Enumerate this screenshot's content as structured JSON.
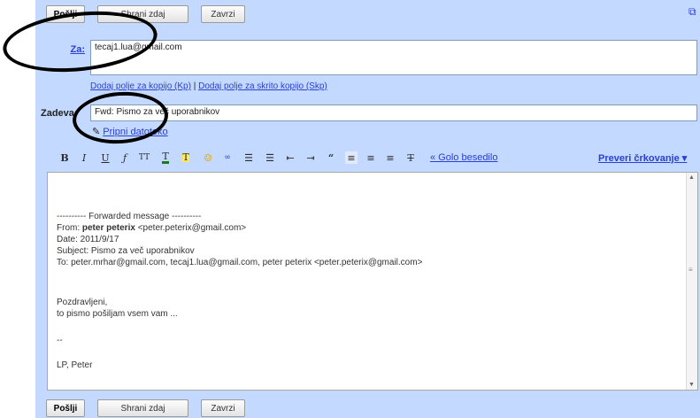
{
  "toolbar_top": {
    "send": "Pošlji",
    "save": "Shrani zdaj",
    "discard": "Zavrzi"
  },
  "to": {
    "label": "Za:",
    "value": "tecaj1.lua@gmail.com"
  },
  "add_fields": {
    "cc": "Dodaj polje za kopijo (Kp)",
    "sep": "|",
    "bcc": "Dodaj polje za skrito kopijo (Skp)"
  },
  "subject": {
    "label": "Zadeva:",
    "value": "Fwd: Pismo za več uporabnikov"
  },
  "attach": "Pripni datoteko",
  "format": {
    "plain_text": "« Golo besedilo",
    "spellcheck": "Preveri črkovanje ▾"
  },
  "body_lines": [
    "---------- Forwarded message ----------",
    "From: ",
    "Date: 2011/9/17",
    "Subject: Pismo za več uporabnikov",
    "To: peter.mrhar@gmail.com, tecaj1.lua@gmail.com, peter peterix <peter.peterix@gmail.com>",
    "",
    "Pozdravljeni,",
    "to pismo pošiljam vsem vam ...",
    "",
    "--",
    "",
    "LP, Peter"
  ],
  "from_name": "peter peterix",
  "from_email": " <peter.peterix@gmail.com>",
  "toolbar_bottom": {
    "send": "Pošlji",
    "save": "Shrani zdaj",
    "discard": "Zavrzi"
  }
}
